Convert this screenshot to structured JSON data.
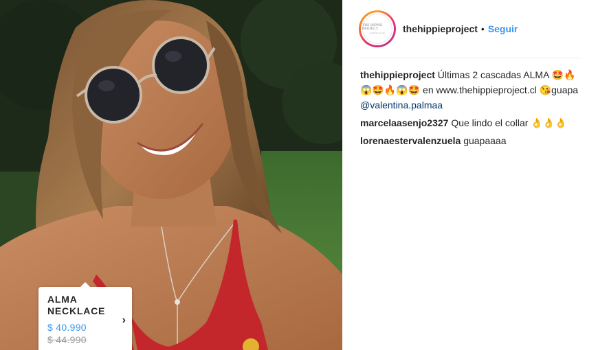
{
  "post": {
    "username": "thehippieproject",
    "separator": "•",
    "follow_label": "Seguir",
    "avatar_text": "THE HIPPIE PROJECT",
    "avatar_subtext": "handmade jewelry"
  },
  "tag": {
    "name": "ALMA NECKLACE",
    "price": "$ 40.990",
    "old_price": "$ 44.990",
    "chevron": "›"
  },
  "caption": {
    "username": "thehippieproject",
    "text_before_mention": "Últimas 2 cascadas ALMA 🤩🔥😱🤩🔥😱🤩 en www.thehippieproject.cl 😘guapa ",
    "mention": "@valentina.palmaa"
  },
  "comments": [
    {
      "username": "marcelaasenjo2327",
      "text": "Que lindo el collar 👌👌👌"
    },
    {
      "username": "lorenaestervalenzuela",
      "text": "guapaaaa"
    }
  ],
  "colors": {
    "link": "#3897f0",
    "mention": "#003569",
    "text": "#262626",
    "old_price": "#999999"
  }
}
